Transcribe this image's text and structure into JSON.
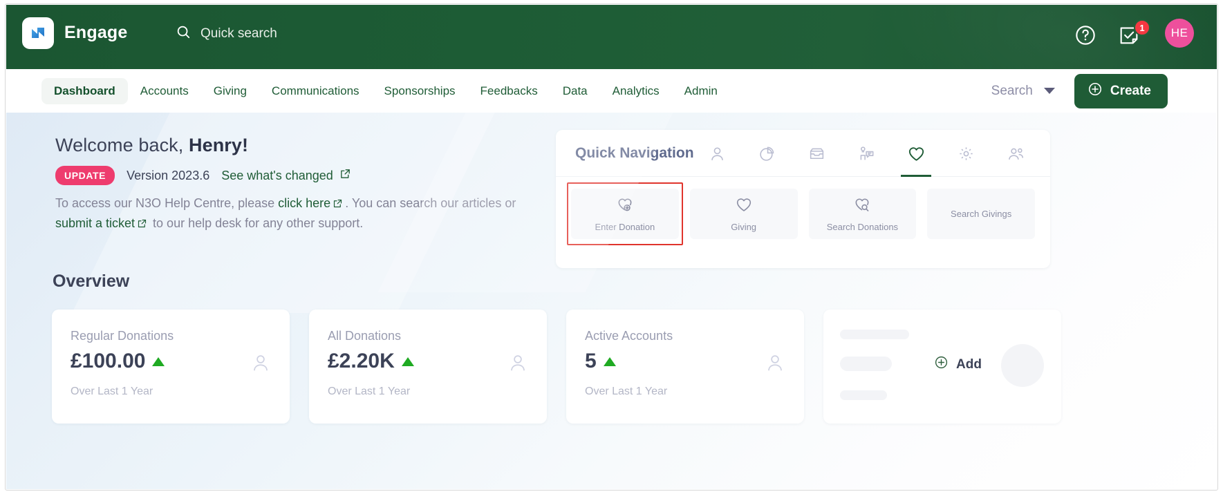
{
  "header": {
    "brand": "Engage",
    "logo_icon": "n3o-logo-icon",
    "quick_search_label": "Quick search",
    "search_icon": "search-icon",
    "help_icon": "help-circle-icon",
    "tasks_icon": "task-check-icon",
    "tasks_badge": "1",
    "avatar_initials": "HE",
    "colors": {
      "bar": "#1d5c35",
      "badge": "#f4333d",
      "avatar": "#ee4d9b"
    }
  },
  "nav": {
    "tabs": [
      {
        "label": "Dashboard",
        "active": true
      },
      {
        "label": "Accounts",
        "active": false
      },
      {
        "label": "Giving",
        "active": false
      },
      {
        "label": "Communications",
        "active": false
      },
      {
        "label": "Sponsorships",
        "active": false
      },
      {
        "label": "Feedbacks",
        "active": false
      },
      {
        "label": "Data",
        "active": false
      },
      {
        "label": "Analytics",
        "active": false
      },
      {
        "label": "Admin",
        "active": false
      }
    ],
    "search_label": "Search",
    "search_caret_icon": "chevron-down-icon",
    "create_label": "Create",
    "create_icon": "plus-circle-icon"
  },
  "welcome": {
    "greeting_prefix": "Welcome back, ",
    "user_name": "Henry!",
    "update_badge": "UPDATE",
    "version": "Version 2023.6",
    "changed_link": "See what's changed",
    "external_icon": "external-link-icon",
    "help_text_1": "To access our N3O Help Centre, please ",
    "help_link_1": "click here",
    "help_text_2": ". You can search our articles or ",
    "help_link_2": "submit a ticket",
    "help_text_3": " to our help desk for any other support."
  },
  "quick_nav": {
    "title": "Quick Navigation",
    "icon_tabs": [
      {
        "name": "person-icon",
        "active": false
      },
      {
        "name": "pie-chart-icon",
        "active": false
      },
      {
        "name": "inbox-icon",
        "active": false
      },
      {
        "name": "person-message-icon",
        "active": false
      },
      {
        "name": "heart-icon",
        "active": true
      },
      {
        "name": "gear-icon",
        "active": false
      },
      {
        "name": "people-icon",
        "active": false
      }
    ],
    "tiles": [
      {
        "label": "Enter Donation",
        "icon": "heart-plus-icon",
        "highlighted": true
      },
      {
        "label": "Giving",
        "icon": "heart-icon",
        "highlighted": false
      },
      {
        "label": "Search Donations",
        "icon": "heart-search-icon",
        "highlighted": false
      },
      {
        "label": "Search Givings",
        "icon": "",
        "highlighted": false
      }
    ],
    "highlight_color": "#e0342c"
  },
  "overview": {
    "title": "Overview",
    "cards": [
      {
        "label": "Regular Donations",
        "value": "£100.00",
        "trend": "up",
        "sub": "Over Last 1 Year",
        "icon": "person-icon"
      },
      {
        "label": "All Donations",
        "value": "£2.20K",
        "trend": "up",
        "sub": "Over Last 1 Year",
        "icon": "person-icon"
      },
      {
        "label": "Active Accounts",
        "value": "5",
        "trend": "up",
        "sub": "Over Last 1 Year",
        "icon": "person-icon"
      }
    ],
    "add_card": {
      "label": "Add",
      "icon": "plus-circle-icon"
    },
    "trend_up_color": "#1faa22"
  }
}
